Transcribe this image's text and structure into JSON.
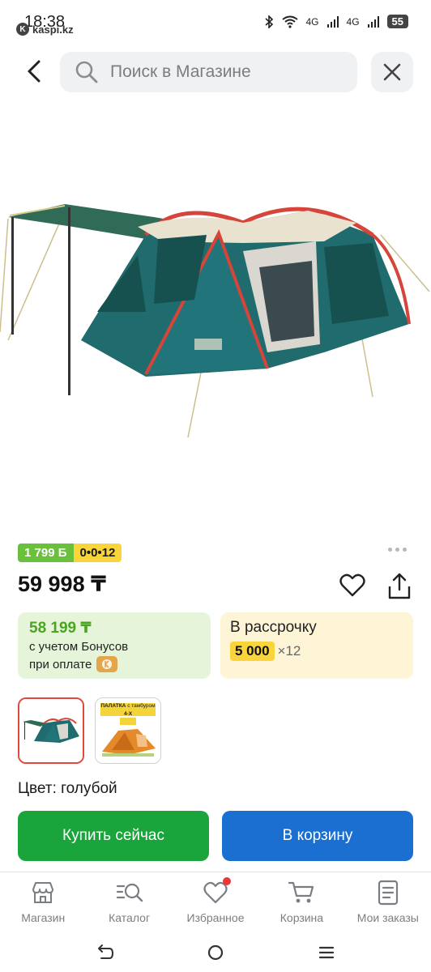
{
  "status_bar": {
    "time": "18:38",
    "app": "kaspi.kz",
    "network_1": "4G",
    "network_2": "4G",
    "battery": "55"
  },
  "header": {
    "search_placeholder": "Поиск в Магазине"
  },
  "product": {
    "bonus_badge": "1 799 Б",
    "installment_badge": "0•0•12",
    "price": "59 998 ₸",
    "bonus_card": {
      "amount": "58 199 ₸",
      "line1": "с учетом Бонусов",
      "line2": "при оплате"
    },
    "installment_card": {
      "title": "В рассрочку",
      "payment": "5 000",
      "multiplier": "×12"
    },
    "thumbnail_2_text": {
      "line1": "ПАЛАТКА",
      "line2": "с тамбуром",
      "line3": "4-Х"
    },
    "color_label": "Цвет: голубой"
  },
  "actions": {
    "buy_now": "Купить сейчас",
    "add_to_cart": "В корзину"
  },
  "bottom_nav": {
    "items": [
      {
        "label": "Магазин",
        "icon": "store-icon"
      },
      {
        "label": "Каталог",
        "icon": "catalog-search-icon"
      },
      {
        "label": "Избранное",
        "icon": "heart-icon"
      },
      {
        "label": "Корзина",
        "icon": "cart-icon"
      },
      {
        "label": "Мои заказы",
        "icon": "orders-icon"
      }
    ]
  },
  "colors": {
    "green": "#1aa53c",
    "blue": "#1a6fd1",
    "bonus_green": "#6abf3b",
    "installment_yellow": "#f9d43a",
    "accent_red": "#e04a3c"
  }
}
